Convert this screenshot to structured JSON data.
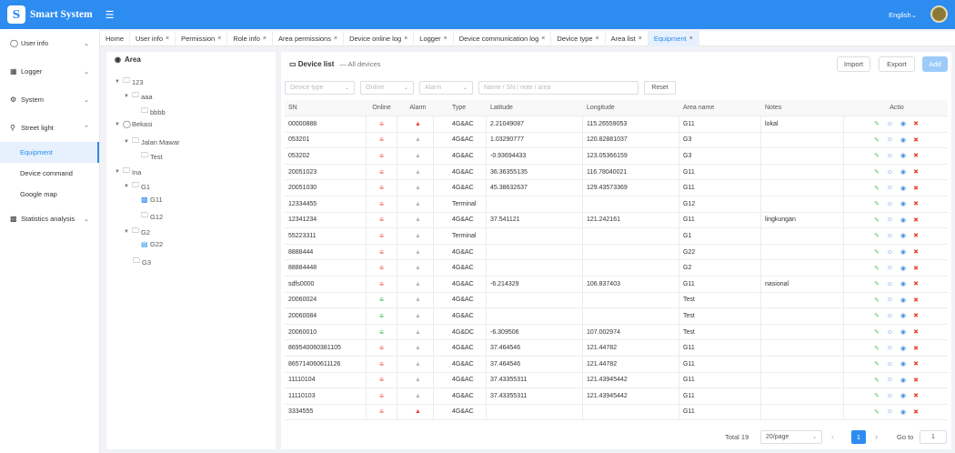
{
  "header": {
    "app_title": "Smart System",
    "logo_letter": "S",
    "language": "English"
  },
  "sidebar": {
    "user_info": "User info",
    "logger": "Logger",
    "system": "System",
    "street_light": "Street light",
    "equipment": "Equipment",
    "device_command": "Device command",
    "google_map": "Google map",
    "statistics": "Statistics analysis"
  },
  "tabs": {
    "home": "Home",
    "user_info": "User info",
    "permission": "Permission",
    "role_info": "Role info",
    "area_permissions": "Area permissions",
    "device_online_log": "Device online log",
    "logger": "Logger",
    "device_comm_log": "Device communication log",
    "device_type": "Device type",
    "area_list": "Area list",
    "equipment": "Equipment"
  },
  "area": {
    "title": "Area",
    "n123": "123",
    "aaa": "aaa",
    "bbbb": "bbbb",
    "bekasi": "Bekasi",
    "jalan": "Jalan Mawar",
    "test": "Test",
    "ina": "Ina",
    "g1": "G1",
    "g11": "G11",
    "g12": "G12",
    "g2": "G2",
    "g22": "G22",
    "g3": "G3"
  },
  "main": {
    "title": "Device list",
    "subtitle": "— All devices",
    "import": "Import",
    "export": "Export",
    "add": "Add",
    "ph_type": "Device type",
    "ph_online": "Online",
    "ph_alarm": "Alarm",
    "ph_search": "Name / SN / note / area",
    "reset": "Reset"
  },
  "columns": {
    "sn": "SN",
    "online": "Online",
    "alarm": "Alarm",
    "type": "Type",
    "lat": "Latitude",
    "lng": "Longitude",
    "area": "Area name",
    "notes": "Notes",
    "action": "Actio"
  },
  "rows": [
    {
      "sn": "00000888",
      "online": false,
      "alarm": true,
      "type": "4G&AC",
      "lat": "2.21049087",
      "lng": "115.26559053",
      "area": "G11",
      "notes": "lokal"
    },
    {
      "sn": "053201",
      "online": false,
      "alarm": false,
      "type": "4G&AC",
      "lat": "1.03290777",
      "lng": "120.82881037",
      "area": "G3",
      "notes": ""
    },
    {
      "sn": "053202",
      "online": false,
      "alarm": false,
      "type": "4G&AC",
      "lat": "-0.93694433",
      "lng": "123.05366159",
      "area": "G3",
      "notes": ""
    },
    {
      "sn": "20051023",
      "online": false,
      "alarm": false,
      "type": "4G&AC",
      "lat": "36.36355135",
      "lng": "116.78040021",
      "area": "G11",
      "notes": ""
    },
    {
      "sn": "20051030",
      "online": false,
      "alarm": false,
      "type": "4G&AC",
      "lat": "45.38632637",
      "lng": "129.43573369",
      "area": "G11",
      "notes": ""
    },
    {
      "sn": "12334455",
      "online": false,
      "alarm": false,
      "type": "Terminal",
      "lat": "",
      "lng": "",
      "area": "G12",
      "notes": ""
    },
    {
      "sn": "12341234",
      "online": false,
      "alarm": false,
      "type": "4G&AC",
      "lat": "37.541121",
      "lng": "121.242161",
      "area": "G11",
      "notes": "lingkungan"
    },
    {
      "sn": "55223311",
      "online": false,
      "alarm": false,
      "type": "Terminal",
      "lat": "",
      "lng": "",
      "area": "G1",
      "notes": ""
    },
    {
      "sn": "8888444",
      "online": false,
      "alarm": false,
      "type": "4G&AC",
      "lat": "",
      "lng": "",
      "area": "G22",
      "notes": ""
    },
    {
      "sn": "88884448",
      "online": false,
      "alarm": false,
      "type": "4G&AC",
      "lat": "",
      "lng": "",
      "area": "G2",
      "notes": ""
    },
    {
      "sn": "sdfs0000",
      "online": false,
      "alarm": false,
      "type": "4G&AC",
      "lat": "-6.214329",
      "lng": "106.837403",
      "area": "G11",
      "notes": "nasional"
    },
    {
      "sn": "20060024",
      "online": true,
      "alarm": false,
      "type": "4G&AC",
      "lat": "",
      "lng": "",
      "area": "Test",
      "notes": ""
    },
    {
      "sn": "20060084",
      "online": true,
      "alarm": false,
      "type": "4G&AC",
      "lat": "",
      "lng": "",
      "area": "Test",
      "notes": ""
    },
    {
      "sn": "20060010",
      "online": true,
      "alarm": false,
      "type": "4G&DC",
      "lat": "-6.309506",
      "lng": "107.002974",
      "area": "Test",
      "notes": ""
    },
    {
      "sn": "869540060381105",
      "online": false,
      "alarm": false,
      "type": "4G&AC",
      "lat": "37.464546",
      "lng": "121.44782",
      "area": "G11",
      "notes": ""
    },
    {
      "sn": "865714060611126",
      "online": false,
      "alarm": false,
      "type": "4G&AC",
      "lat": "37.464546",
      "lng": "121.44782",
      "area": "G11",
      "notes": ""
    },
    {
      "sn": "11110104",
      "online": false,
      "alarm": false,
      "type": "4G&AC",
      "lat": "37.43355311",
      "lng": "121.43945442",
      "area": "G11",
      "notes": ""
    },
    {
      "sn": "11110103",
      "online": false,
      "alarm": false,
      "type": "4G&AC",
      "lat": "37.43355311",
      "lng": "121.43945442",
      "area": "G11",
      "notes": ""
    },
    {
      "sn": "3334555",
      "online": false,
      "alarm": true,
      "type": "4G&AC",
      "lat": "",
      "lng": "",
      "area": "G11",
      "notes": ""
    }
  ],
  "pager": {
    "total": "Total 19",
    "per_page": "20/page",
    "page": "1",
    "goto": "Go to",
    "goto_value": "1"
  },
  "colors": {
    "accent": "#2d8cf0",
    "offline": "#e8443a",
    "online": "#2bb24c",
    "alarm_on": "#e8443a",
    "alarm_off": "#b9b9b9",
    "edit": "#58c26e",
    "user": "#4a90e2",
    "pin": "#4a90e2",
    "delete": "#e8443a"
  }
}
